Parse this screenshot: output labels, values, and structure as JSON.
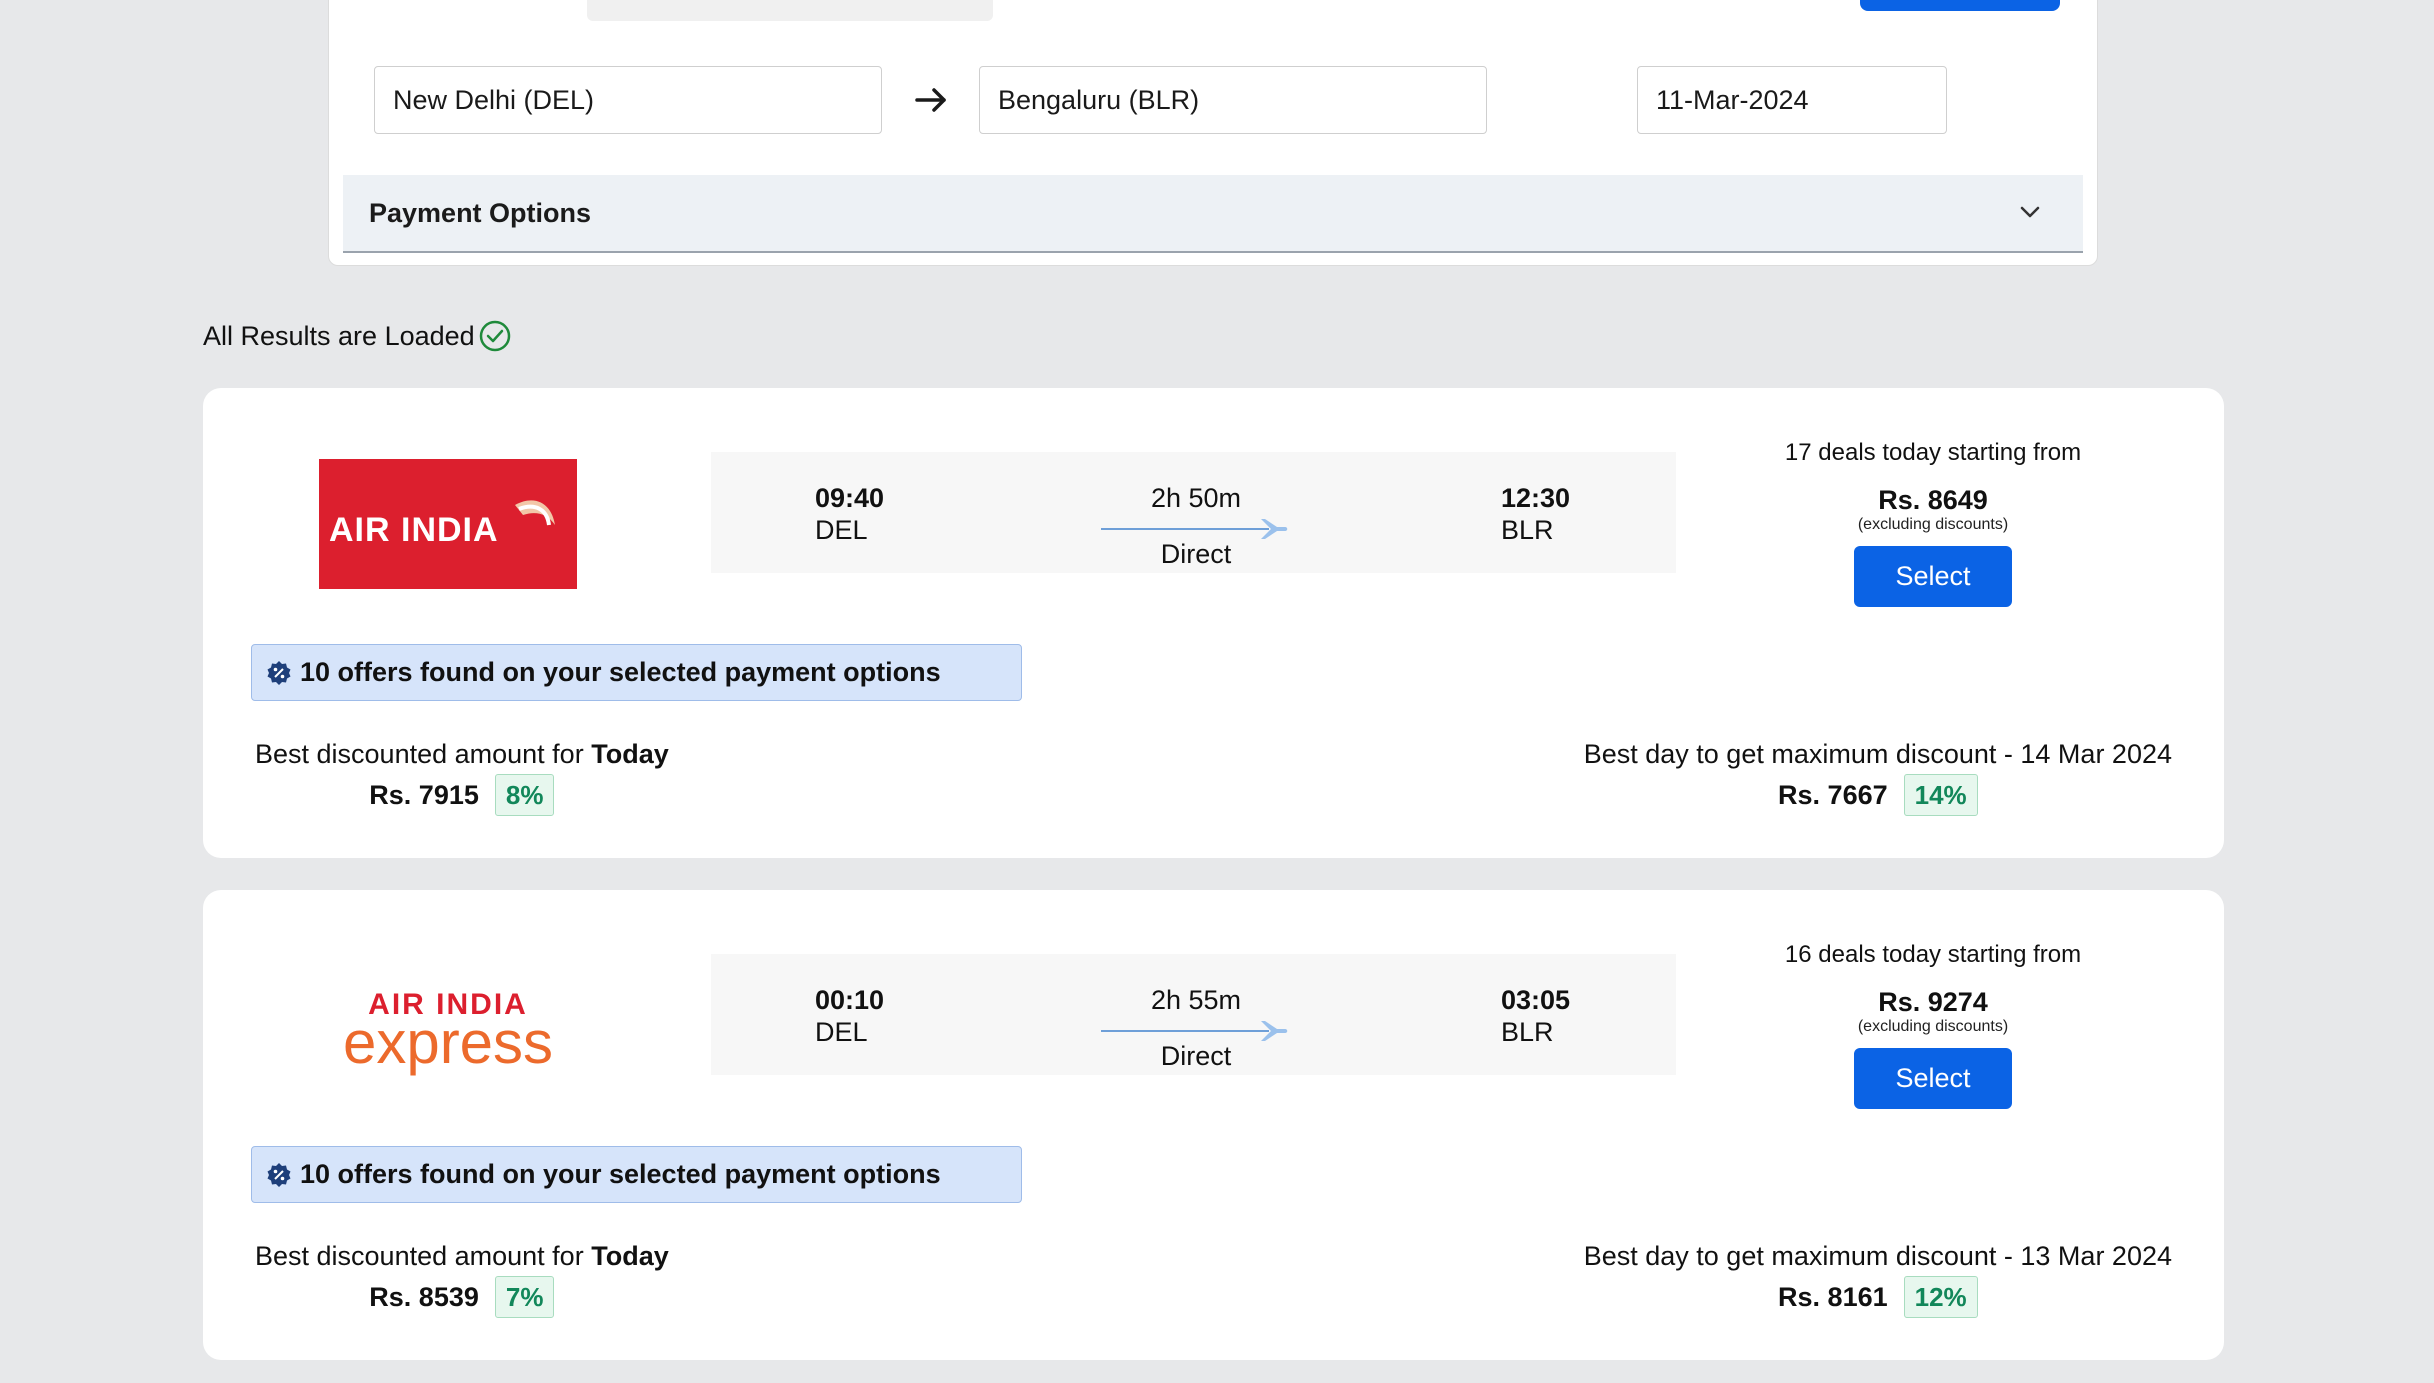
{
  "search": {
    "from": "New Delhi (DEL)",
    "to": "Bengaluru (BLR)",
    "date": "11-Mar-2024",
    "payment_options_label": "Payment Options"
  },
  "status": {
    "text": "All Results are Loaded"
  },
  "flights": [
    {
      "airline": "AIR INDIA",
      "dep_time": "09:40",
      "dep_code": "DEL",
      "duration": "2h 50m",
      "stops": "Direct",
      "arr_time": "12:30",
      "arr_code": "BLR",
      "deals_text": "17 deals today starting from",
      "price": "Rs. 8649",
      "price_note": "(excluding discounts)",
      "select_label": "Select",
      "offers_text": "10 offers found on your selected payment options",
      "best_today_prefix": "Best discounted amount for",
      "best_today_bold": "Today",
      "best_today_amount": "Rs. 7915",
      "best_today_pct": "8%",
      "best_day_text": "Best day to get maximum discount - 14 Mar 2024",
      "best_day_amount": "Rs. 7667",
      "best_day_pct": "14%"
    },
    {
      "airline_top": "AIR INDIA",
      "airline_bottom": "express",
      "dep_time": "00:10",
      "dep_code": "DEL",
      "duration": "2h 55m",
      "stops": "Direct",
      "arr_time": "03:05",
      "arr_code": "BLR",
      "deals_text": "16 deals today starting from",
      "price": "Rs. 9274",
      "price_note": "(excluding discounts)",
      "select_label": "Select",
      "offers_text": "10 offers found on your selected payment options",
      "best_today_prefix": "Best discounted amount for",
      "best_today_bold": "Today",
      "best_today_amount": "Rs. 8539",
      "best_today_pct": "7%",
      "best_day_text": "Best day to get maximum discount - 13 Mar 2024",
      "best_day_amount": "Rs. 8161",
      "best_day_pct": "12%"
    }
  ],
  "colors": {
    "primary": "#0b63e5",
    "air_india_red": "#dc1f2e",
    "express_orange": "#ec6a2c",
    "discount_green": "#12875a",
    "success_green": "#1f8a3b"
  },
  "icons": {
    "swap": "arrow-right-icon",
    "chevron": "chevron-down-icon",
    "loaded": "check-circle-icon",
    "offer": "discount-badge-icon",
    "plane": "plane-icon"
  }
}
